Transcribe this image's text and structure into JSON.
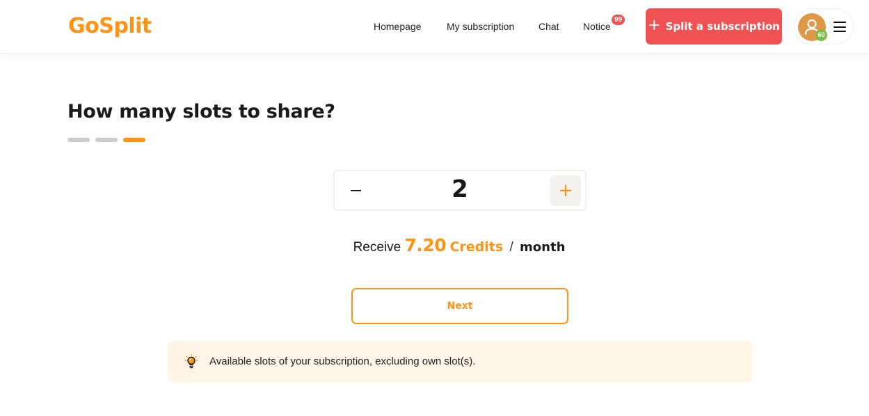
{
  "header": {
    "logo": "GoSplit",
    "nav": [
      {
        "label": "Homepage"
      },
      {
        "label": "My subscription"
      },
      {
        "label": "Chat"
      },
      {
        "label": "Notice"
      }
    ],
    "notice_badge": "99",
    "split_button": {
      "icon": "plus-icon",
      "label": "Split a subscription"
    },
    "user": {
      "avatar_icon": "user-icon",
      "level": "60",
      "menu_icon": "hamburger-menu-icon"
    }
  },
  "main": {
    "title": "How many slots to share?",
    "progress": {
      "total_steps": 3,
      "current_step": 3
    },
    "stepper": {
      "minus_label": "−",
      "value": "2",
      "plus_label": "+"
    },
    "receive": {
      "prefix": "Receive",
      "amount": "7.20",
      "unit": "Credits",
      "separator": "/",
      "period": "month"
    },
    "next_label": "Next",
    "tip": {
      "icon": "lightbulb-icon",
      "text": "Available slots of your subscription, excluding own slot(s)."
    }
  },
  "colors": {
    "brand": "#ff9414",
    "split_button": "#f05253",
    "badge": "#ee5253",
    "tip_background": "#fff4e6",
    "level_badge": "#7bc043",
    "avatar": "#de9848"
  }
}
